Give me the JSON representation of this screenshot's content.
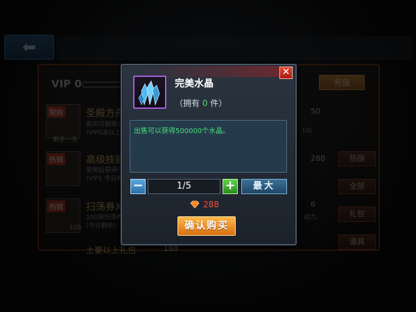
{
  "background": {
    "back_icon": "back-arrow-icon",
    "vip_label": "VIP 0",
    "recharge_label": "充值",
    "items": [
      {
        "tag": "限购",
        "name": "圣殿方舟",
        "desc": "购买可获得1个圣殿方舟",
        "desc2": "(VIP0及以上)",
        "sub": "剩余一天",
        "price": "50",
        "desc_end": "10)"
      },
      {
        "tag": "热销",
        "name": "高级技能书",
        "desc": "使用后获得强大技能",
        "desc2": "(VIP1 今日剩余)",
        "price": "288"
      },
      {
        "tag": "热销",
        "name": "扫荡券X",
        "desc": "100张扫荡券",
        "desc2": "(今日剩余)",
        "price": "6",
        "icon_count": "100",
        "desc_end": "动力。"
      },
      {
        "name": "土豪以上礼包",
        "price": "188"
      }
    ],
    "side_tabs": [
      "热销",
      "全部",
      "礼包",
      "道具"
    ]
  },
  "dialog": {
    "close_icon": "close-icon",
    "item_icon": "crystal-icon",
    "item_title": "完美水晶",
    "own_prefix": "（拥有 ",
    "own_count": "0",
    "own_suffix": " 件）",
    "description": "出售可以获得500000个水晶。",
    "quantity": "1/5",
    "minus_label": "−",
    "plus_label": "+",
    "max_label": "最大",
    "price_icon": "gem-icon",
    "price": "288",
    "confirm_label": "确认购买"
  },
  "colors": {
    "accent_orange": "#d96f10",
    "price_red": "#ff4a3a",
    "desc_green": "#46e07a",
    "count_green": "#4cd964",
    "item_border_purple": "#a65cd8"
  }
}
